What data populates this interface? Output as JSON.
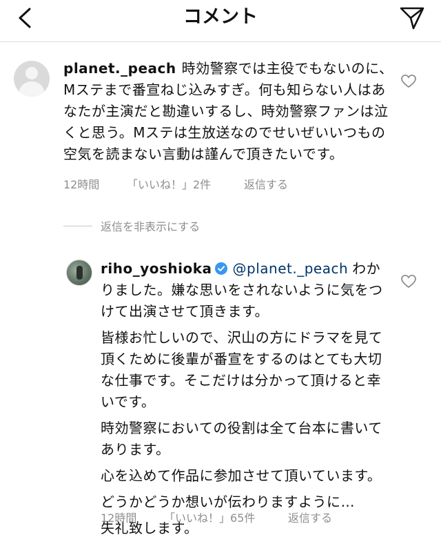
{
  "header": {
    "title": "コメント",
    "back_icon": "chevron-left-icon",
    "share_icon": "paper-plane-icon"
  },
  "comments": [
    {
      "username": "planet._peach",
      "text": "時効警察では主役でもないのに、Mステまで番宣ねじ込みすぎ。何も知らない人はあなたが主演だと勘違いするし、時効警察ファンは泣くと思う。Mステは生放送なのでせいぜいいつもの空気を読まない言動は謹んで頂きたいです。",
      "time": "12時間",
      "likes": "「いいね！」2件",
      "reply_label": "返信する"
    },
    {
      "username": "riho_yoshioka",
      "verified": true,
      "mention": "@planet._peach",
      "paragraphs": [
        "わかりました。嫌な思いをされないように気をつけて出演させて頂きます。",
        "皆様お忙しいので、沢山の方にドラマを見て頂くために後輩が番宣をするのはとても大切な仕事です。そこだけは分かって頂けると幸いです。",
        "時効警察においての役割は全て台本に書いてあります。",
        "心を込めて作品に参加させて頂いています。",
        "どうかどうか想いが伝わりますように…",
        "失礼致します。"
      ],
      "time": "12時間",
      "likes": "「いいね！」65件",
      "reply_label": "返信する"
    }
  ],
  "hide_replies_label": "返信を非表示にする",
  "colors": {
    "mention": "#003569",
    "meta": "#8e8e8e",
    "verified": "#3897f0"
  }
}
